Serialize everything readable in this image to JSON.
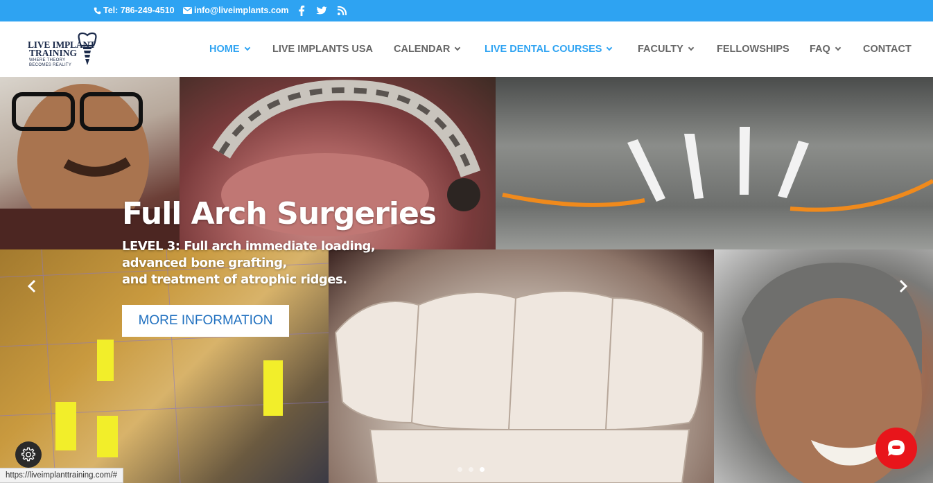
{
  "topbar": {
    "phone": "Tel: 786-249-4510",
    "email": "info@liveimplants.com",
    "social": [
      "facebook-icon",
      "twitter-icon",
      "rss-icon"
    ]
  },
  "logo": {
    "line1": "LIVE IMPLANT",
    "line2": "TRAINING",
    "tagline1": "WHERE THEORY",
    "tagline2": "BECOMES REALITY"
  },
  "nav": {
    "items": [
      {
        "label": "HOME",
        "dropdown": true,
        "active": true
      },
      {
        "label": "LIVE IMPLANTS USA",
        "dropdown": false,
        "active": false
      },
      {
        "label": "CALENDAR",
        "dropdown": true,
        "active": false
      },
      {
        "label": "LIVE DENTAL COURSES",
        "dropdown": true,
        "active": true
      },
      {
        "label": "FACULTY",
        "dropdown": true,
        "active": false
      },
      {
        "label": "FELLOWSHIPS",
        "dropdown": false,
        "active": false
      },
      {
        "label": "FAQ",
        "dropdown": true,
        "active": false
      },
      {
        "label": "CONTACT",
        "dropdown": false,
        "active": false
      }
    ]
  },
  "hero": {
    "title": "Full Arch Surgeries",
    "subtitle_line1": "LEVEL 3: Full arch immediate loading,",
    "subtitle_line2": "advanced bone grafting,",
    "subtitle_line3": "and treatment of atrophic ridges.",
    "button": "MORE INFORMATION",
    "slide_count": 3,
    "active_slide": 3
  },
  "status_url": "https://liveimplanttraining.com/#",
  "colors": {
    "accent": "#2ea3f2",
    "button_text": "#1e6fbf",
    "chat": "#e8151b"
  }
}
